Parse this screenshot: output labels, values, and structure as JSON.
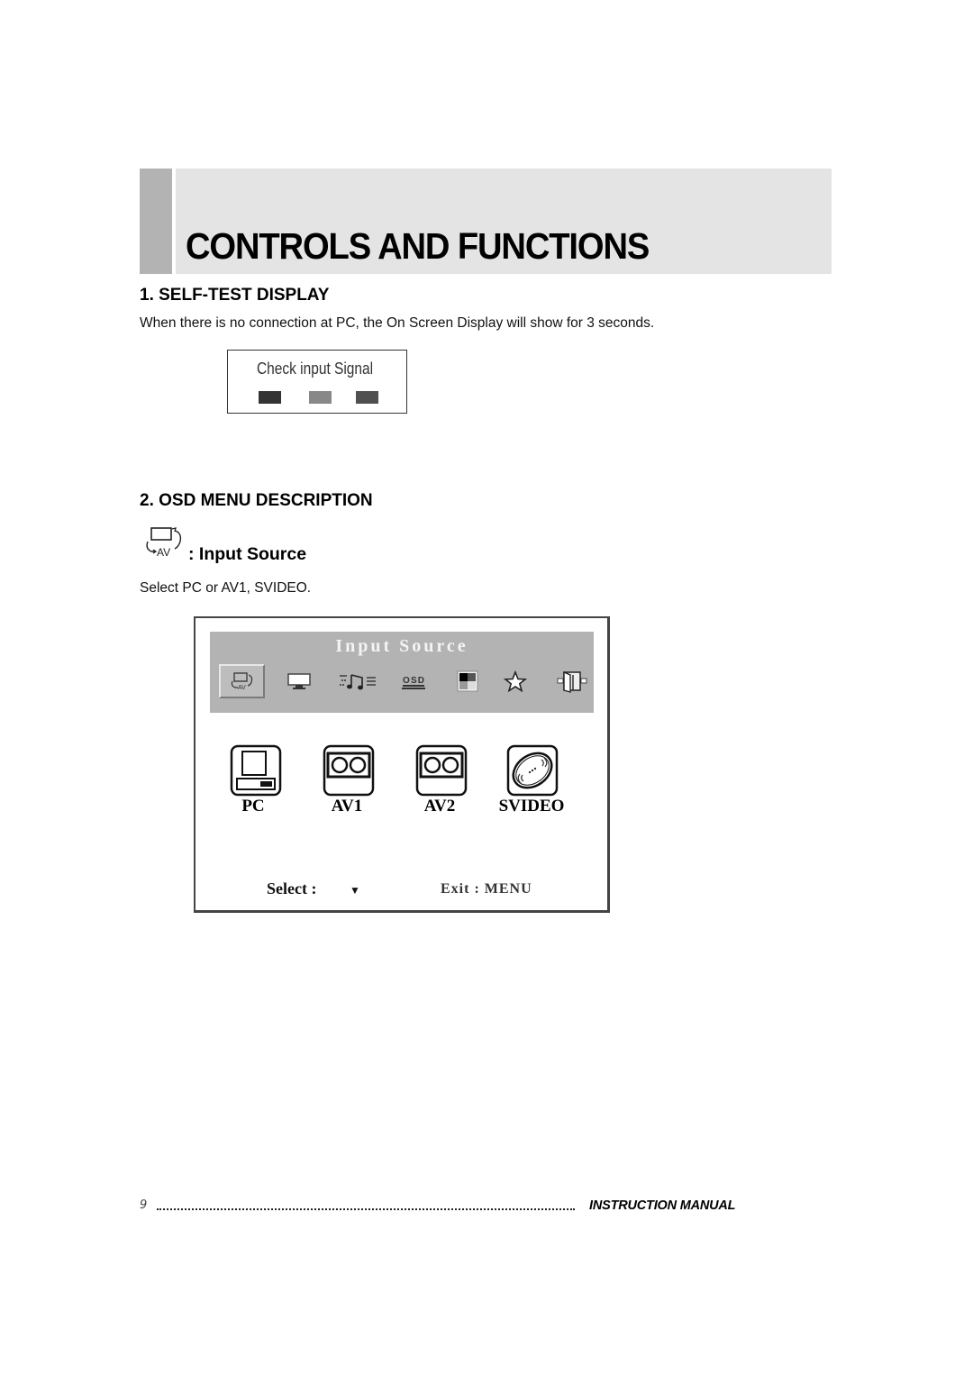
{
  "header": {
    "title": "CONTROLS AND FUNCTIONS"
  },
  "section1": {
    "heading": "1. SELF-TEST DISPLAY",
    "description": "When there is no connection at PC, the On Screen Display will show for 3 seconds.",
    "osd_message": {
      "text": "Check input Signal",
      "swatch_colors": [
        "#333333",
        "#888888",
        "#505050"
      ]
    }
  },
  "section2": {
    "heading": "2. OSD MENU DESCRIPTION",
    "item_icon": "input-source-icon",
    "item_label": ": Input Source",
    "description": "Select PC or AV1, SVIDEO.",
    "osd_menu": {
      "title": "Input Source",
      "tabs": [
        {
          "icon": "input-source-icon",
          "selected": true
        },
        {
          "icon": "monitor-icon",
          "selected": false
        },
        {
          "icon": "audio-icon",
          "selected": false
        },
        {
          "icon": "osd-settings-icon",
          "selected": false
        },
        {
          "icon": "color-icon",
          "selected": false
        },
        {
          "icon": "favorite-star-icon",
          "selected": false
        },
        {
          "icon": "exit-door-icon",
          "selected": false
        }
      ],
      "sources": [
        {
          "label": "PC",
          "icon": "pc-icon"
        },
        {
          "label": "AV1",
          "icon": "vcr-icon"
        },
        {
          "label": "AV2",
          "icon": "vcr-icon"
        },
        {
          "label": "SVIDEO",
          "icon": "svideo-disc-icon"
        }
      ],
      "select_label": "Select :",
      "select_arrow": "▼",
      "exit_label": "Exit : MENU"
    }
  },
  "footer": {
    "page_number": "9",
    "title": "INSTRUCTION MANUAL"
  }
}
